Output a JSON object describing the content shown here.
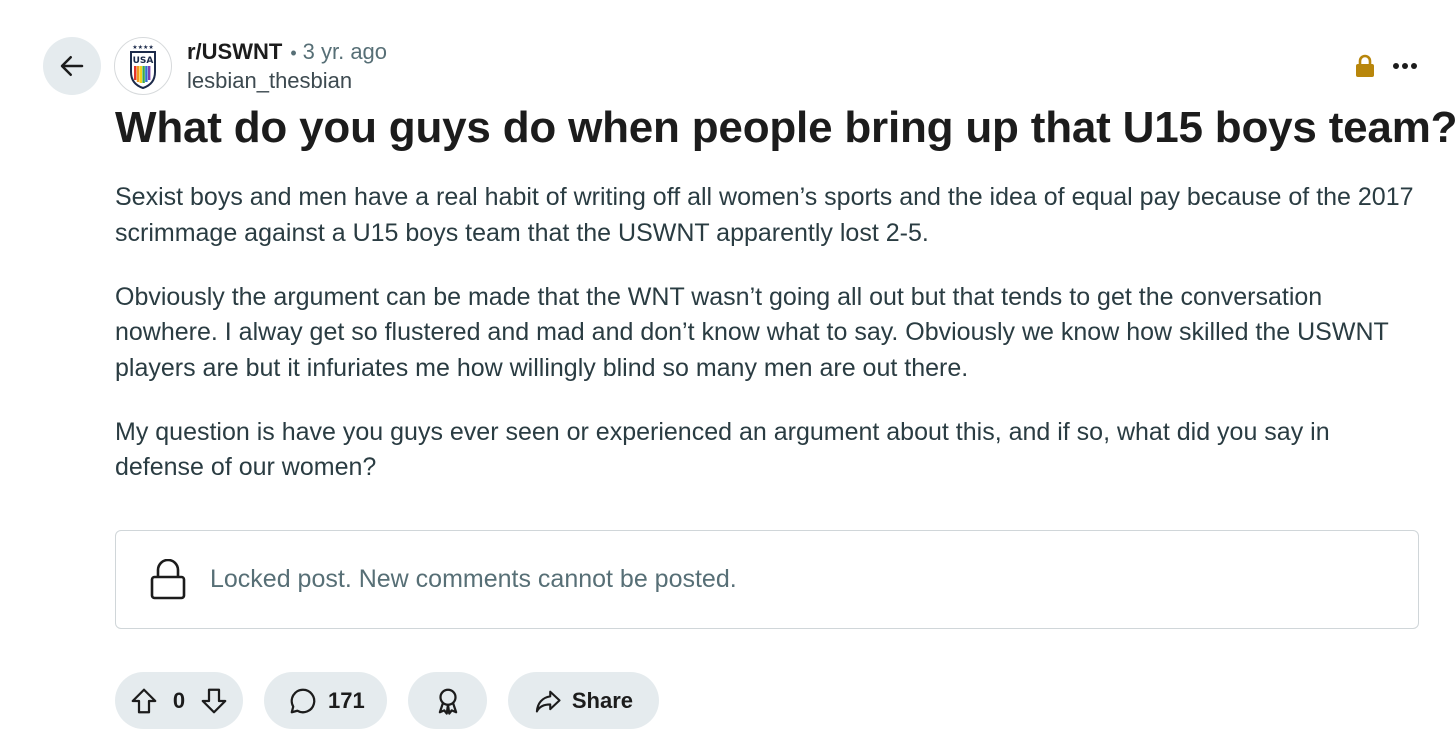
{
  "post": {
    "subreddit": "r/USWNT",
    "separator": "•",
    "age": "3 yr. ago",
    "author": "lesbian_thesbian",
    "title": "What do you guys do when people bring up that U15 boys team?",
    "paragraphs": [
      "Sexist boys and men have a real habit of writing off all women’s sports and the idea of equal pay because of the 2017 scrimmage against a U15 boys team that the USWNT apparently lost 2-5.",
      "Obviously the argument can be made that the WNT wasn’t going all out but that tends to get the conversation nowhere. I alway get so flustered and mad and don’t know what to say. Obviously we know how skilled the USWNT players are but it infuriates me how willingly blind so many men are out there.",
      "My question is have you guys ever seen or experienced an argument about this, and if so, what did you say in defense of our women?"
    ],
    "locked_notice": "Locked post. New comments cannot be posted.",
    "avatar_text": "USA",
    "avatar_stars": "★★★★"
  },
  "actions": {
    "vote_count": "0",
    "comment_count": "171",
    "share_label": "Share"
  },
  "icons": {
    "back": "arrow-left-icon",
    "lock_badge": "lock-icon",
    "more": "ellipsis-icon",
    "upvote": "arrow-up-icon",
    "downvote": "arrow-down-icon",
    "comment": "speech-bubble-icon",
    "award": "award-icon",
    "share": "share-arrow-icon"
  },
  "colors": {
    "pill_bg": "#e5ebee",
    "lock_badge": "#b8860b",
    "muted_text": "#576f76"
  }
}
